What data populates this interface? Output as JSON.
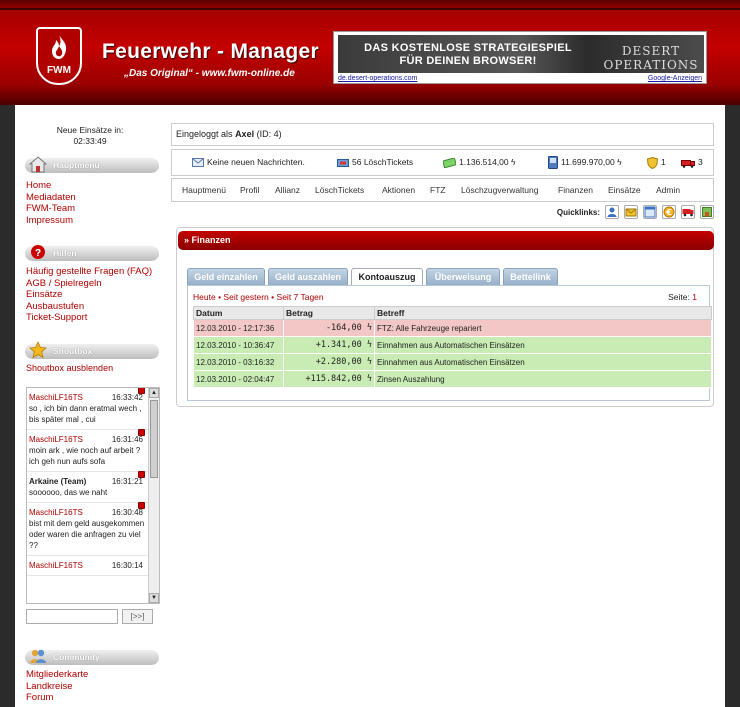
{
  "header": {
    "title": "Feuerwehr - Manager",
    "subtitle": "„Das Original“ - www.fwm-online.de",
    "logo_text": "FWM",
    "ad": {
      "text_line1": "DAS KOSTENLOSE STRATEGIESPIEL",
      "text_line2": "FÜR DEINEN BROWSER!",
      "brand": "DESERT OPERATIONS",
      "link_left": "de.desert-operations.com",
      "link_right": "Google-Anzeigen"
    }
  },
  "sidebar": {
    "missions_label": "Neue Einsätze in:",
    "missions_timer": "02:33:49",
    "mainmenu": {
      "title": "Hauptmenü",
      "items": [
        "Home",
        "Mediadaten",
        "FWM-Team",
        "Impressum"
      ]
    },
    "help": {
      "title": "Hilfen",
      "items": [
        "Häufig gestellte Fragen (FAQ)",
        "AGB / Spielregeln",
        "Einsätze",
        "Ausbaustufen",
        "Ticket-Support"
      ]
    },
    "shoutbox": {
      "title": "Shoutbox",
      "hide_label": "Shoutbox ausblenden",
      "send_label": "[>>]",
      "messages": [
        {
          "user": "MaschiLF16TS",
          "team": "",
          "time": "16:33:42",
          "text": "so , ich bin dann eratmal wech , bis später mal , cui"
        },
        {
          "user": "MaschiLF16TS",
          "team": "",
          "time": "16:31:46",
          "text": "moin ark , wie noch auf arbeit ? ich geh nun aufs sofa"
        },
        {
          "user": "Arkaine",
          "team": "(Team)",
          "time": "16:31:21",
          "text": "soooooo, das we naht"
        },
        {
          "user": "MaschiLF16TS",
          "team": "",
          "time": "16:30:48",
          "text": "bist mit dem geld ausgekommen oder waren die anfragen zu viel ??"
        },
        {
          "user": "MaschiLF16TS",
          "team": "",
          "time": "16:30:14",
          "text": ""
        }
      ]
    },
    "community": {
      "title": "Community",
      "items": [
        "Mitgliederkarte",
        "Landkreise",
        "Forum"
      ]
    }
  },
  "loginbar": {
    "prefix": "Eingeloggt als",
    "user": "Axel",
    "id": "(ID: 4)"
  },
  "status": {
    "messages": "Keine neuen Nachrichten.",
    "tickets": "56 LöschTickets",
    "money": "1.136.514,00 ϟ",
    "bank": "11.699.970,00 ϟ",
    "badges": "1",
    "vehicles": "3"
  },
  "menu": [
    "Hauptmenü",
    "Profil",
    "Allianz",
    "LöschTickets",
    "Aktionen",
    "FTZ",
    "Löschzugverwaltung",
    "Finanzen",
    "Einsätze",
    "Admin"
  ],
  "quicklinks_label": "Quicklinks:",
  "panel": {
    "title": "Finanzen",
    "tabs": [
      "Geld einzahlen",
      "Geld auszahlen",
      "Kontoauszug",
      "Überweisung",
      "Bettellink"
    ],
    "active_tab": "Kontoauszug",
    "filters": [
      "Heute",
      "Seit gestern",
      "Seit 7 Tagen"
    ],
    "filter_sep": "•",
    "page_label": "Seite:",
    "page_number": "1",
    "columns": [
      "Datum",
      "Betrag",
      "Betreff"
    ],
    "rows": [
      {
        "date": "12.03.2010 - 12:17:36",
        "amount": "-164,00 ϟ",
        "subject": "FTZ: Alle Fahrzeuge repariert",
        "kind": "neg"
      },
      {
        "date": "12.03.2010 - 10:36:47",
        "amount": "+1.341,00 ϟ",
        "subject": "Einnahmen aus Automatischen Einsätzen",
        "kind": "pos"
      },
      {
        "date": "12.03.2010 - 03:16:32",
        "amount": "+2.280,00 ϟ",
        "subject": "Einnahmen aus Automatischen Einsätzen",
        "kind": "pos"
      },
      {
        "date": "12.03.2010 - 02:04:47",
        "amount": "+115.842,00 ϟ",
        "subject": "Zinsen Auszahlung",
        "kind": "pos"
      }
    ]
  },
  "colors": {
    "brand_red": "#b00000",
    "header_red": "#c40000",
    "row_negative": "#f4c7c7",
    "row_positive": "#c8ecb4",
    "tab_blue": "#97b0c8"
  },
  "icons": {
    "logo": "flame-icon",
    "mainmenu": "house-icon",
    "help": "question-icon",
    "shoutbox": "star-icon",
    "community": "people-icon",
    "messages": "envelope-icon",
    "tickets": "ticket-icon",
    "money": "cash-icon",
    "bank": "phone-icon",
    "badges": "shield-icon",
    "vehicles": "fire-truck-icon"
  }
}
